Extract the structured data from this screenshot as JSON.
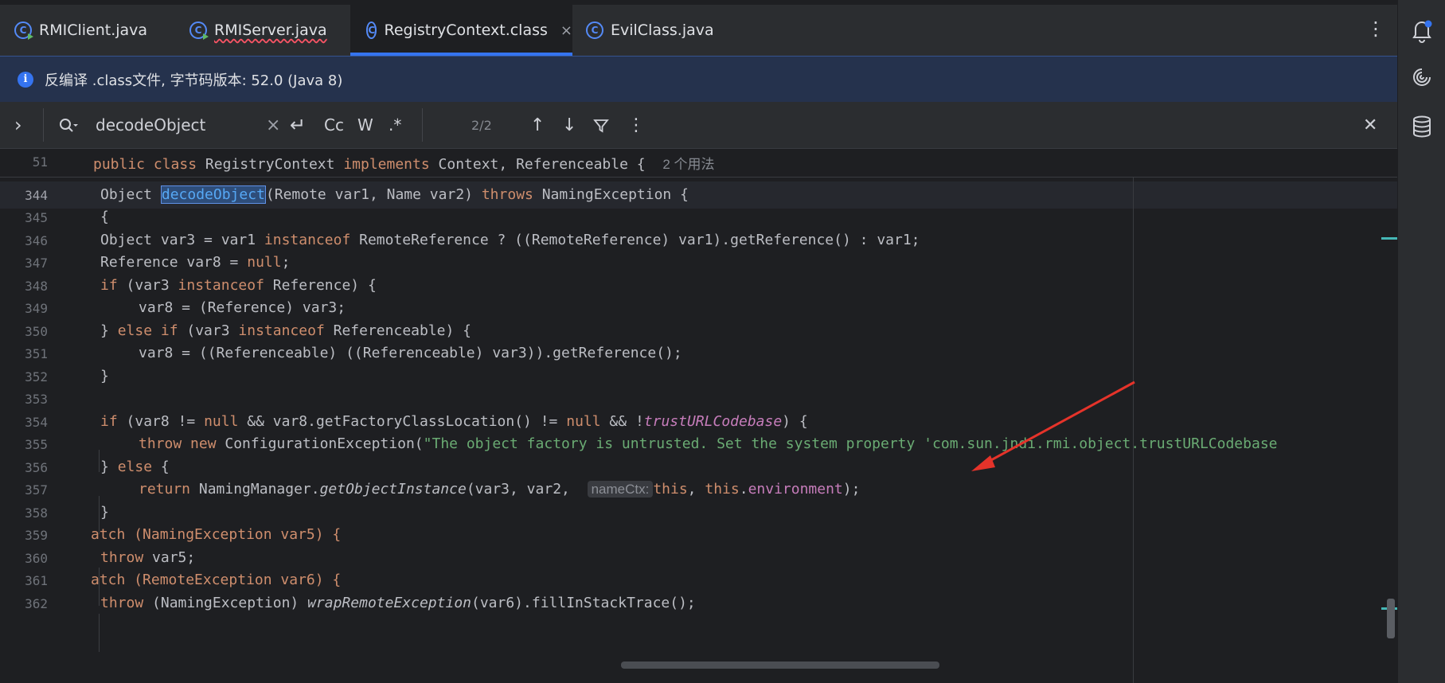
{
  "tabs": [
    {
      "label": "RMIClient.java",
      "icon": "java-class-run-icon"
    },
    {
      "label": "RMIServer.java",
      "icon": "java-class-run-icon"
    },
    {
      "label": "RegistryContext.class",
      "icon": "class-file-icon",
      "active": true,
      "close": "×"
    },
    {
      "label": "EvilClass.java",
      "icon": "java-class-icon"
    }
  ],
  "tab_more_icon": "⋮",
  "banner": {
    "text": "反编译 .class文件, 字节码版本: 52.0 (Java 8)",
    "icon": "i"
  },
  "search": {
    "expand": "›",
    "value": "decodeObject",
    "clear": "×",
    "options": {
      "newline": "↵",
      "case": "Cc",
      "words": "W",
      "regex": ".*"
    },
    "count": "2/2",
    "prev": "↑",
    "next": "↓",
    "more": "⋮",
    "close": "✕"
  },
  "sticky": {
    "line": "51",
    "code": [
      "public",
      "class",
      "RegistryContext",
      "implements",
      "Context, Referenceable {"
    ],
    "usages": "2 个用法"
  },
  "lines": {
    "l344": {
      "num": "344",
      "a": "Object ",
      "match": "decodeObject",
      "b": "(Remote var1, Name var2) ",
      "kw": "throws",
      "c": " NamingException {"
    },
    "l345": {
      "num": "345",
      "text": "{"
    },
    "l346": {
      "num": "346",
      "a": "Object var3 = var1 ",
      "kw": "instanceof",
      "b": " RemoteReference ? ((RemoteReference) var1).getReference() : var1;"
    },
    "l347": {
      "num": "347",
      "a": "Reference var8 = ",
      "kw": "null",
      "b": ";"
    },
    "l348": {
      "num": "348",
      "kw1": "if",
      "a": " (var3 ",
      "kw2": "instanceof",
      "b": " Reference) {"
    },
    "l349": {
      "num": "349",
      "text": "var8 = (Reference) var3;"
    },
    "l350": {
      "num": "350",
      "a": "} ",
      "kw1": "else if",
      "b": " (var3 ",
      "kw2": "instanceof",
      "c": " Referenceable) {"
    },
    "l351": {
      "num": "351",
      "text": "var8 = ((Referenceable) ((Referenceable) var3)).getReference();"
    },
    "l352": {
      "num": "352",
      "text": "}"
    },
    "l353": {
      "num": "353"
    },
    "l354": {
      "num": "354",
      "kw1": "if",
      "a": " (var8 != ",
      "kw2": "null",
      "b": " && var8.getFactoryClassLocation() != ",
      "kw3": "null",
      "c": " && !",
      "ital": "trustURLCodebase",
      "d": ") {"
    },
    "l355": {
      "num": "355",
      "kw": "throw new",
      "a": " ConfigurationException(",
      "str": "\"The object factory is untrusted. Set the system property 'com.sun.jndi.rmi.object.trustURLCodebase"
    },
    "l356": {
      "num": "356",
      "a": "} ",
      "kw": "else",
      "b": " {"
    },
    "l357": {
      "num": "357",
      "kw": "return",
      "a": " NamingManager.",
      "ital": "getObjectInstance",
      "b": "(var3, var2, ",
      "hint": "nameCtx:",
      "kw2": "this",
      "c": ", ",
      "kw3": "this",
      "d": ".",
      "fld": "environment",
      "e": ");"
    },
    "l358": {
      "num": "358",
      "text": "}"
    },
    "l359": {
      "num": "359",
      "a": "atch (NamingException var5) {"
    },
    "l360": {
      "num": "360",
      "kw": "throw",
      "a": " var5;"
    },
    "l361": {
      "num": "361",
      "a": "atch (RemoteException var6) {"
    },
    "l362": {
      "num": "362",
      "kw": "throw",
      "a": " (NamingException) ",
      "ital": "wrapRemoteException",
      "b": "(var6).fillInStackTrace();"
    }
  },
  "colors": {
    "accent": "#3574f0",
    "keyword": "#cf8e6d",
    "string": "#6aab73",
    "annotation_arrow": "#e5332a"
  }
}
